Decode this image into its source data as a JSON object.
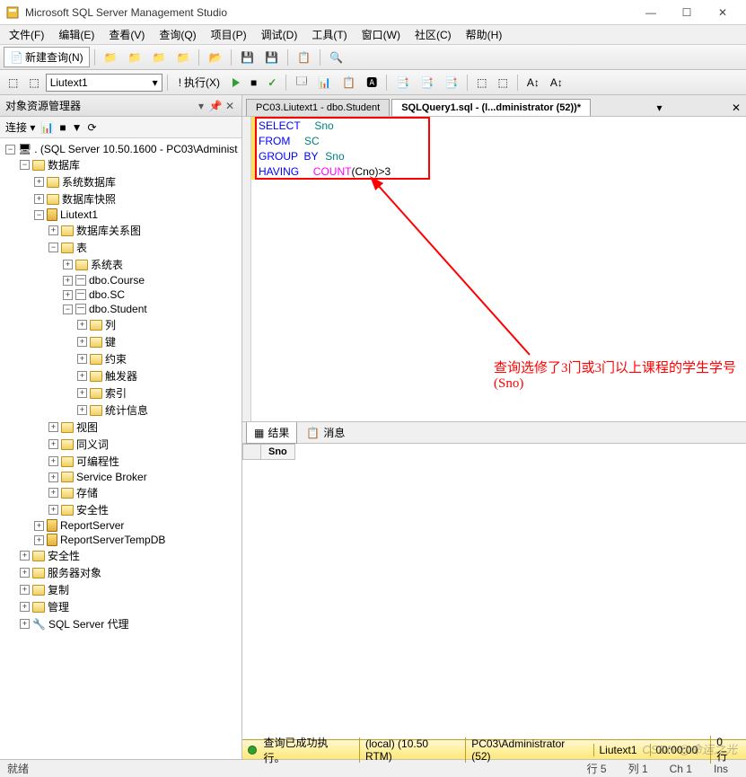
{
  "window": {
    "title": "Microsoft SQL Server Management Studio"
  },
  "menu": {
    "file": "文件(F)",
    "edit": "编辑(E)",
    "view": "查看(V)",
    "query": "查询(Q)",
    "project": "项目(P)",
    "debug": "调试(D)",
    "tools": "工具(T)",
    "window": "窗口(W)",
    "community": "社区(C)",
    "help": "帮助(H)"
  },
  "toolbar": {
    "newquery": "新建查询(N)",
    "database": "Liutext1",
    "execute": "执行(X)"
  },
  "objectExplorer": {
    "title": "对象资源管理器",
    "connect": "连接 ▾",
    "root": ". (SQL Server 10.50.1600 - PC03\\Administ",
    "nodes": {
      "databases": "数据库",
      "sysdb": "系统数据库",
      "dbsnap": "数据库快照",
      "liutext1": "Liutext1",
      "dbdiagram": "数据库关系图",
      "tables": "表",
      "systables": "系统表",
      "course": "dbo.Course",
      "sc": "dbo.SC",
      "student": "dbo.Student",
      "columns": "列",
      "keys": "键",
      "constraints": "约束",
      "triggers": "触发器",
      "indexes": "索引",
      "stats": "统计信息",
      "views": "视图",
      "synonyms": "同义词",
      "programmability": "可编程性",
      "servicebroker": "Service Broker",
      "storage": "存储",
      "security_db": "安全性",
      "reportserver": "ReportServer",
      "reportservertempdb": "ReportServerTempDB",
      "security": "安全性",
      "serverobjects": "服务器对象",
      "replication": "复制",
      "management": "管理",
      "sqlagent": "SQL Server 代理"
    }
  },
  "tabs": {
    "tab1": "PC03.Liutext1 - dbo.Student",
    "tab2": "SQLQuery1.sql - (l...dministrator (52))*"
  },
  "sql": {
    "l1_kw1": "SELECT",
    "l1_id": "Sno",
    "l2_kw": "FROM",
    "l2_id": "SC",
    "l3_kw": "GROUP  BY",
    "l3_id": "Sno",
    "l4_kw": "HAVING",
    "l4_fn": "COUNT",
    "l4_pa": "(Cno)>",
    "l4_num": "3"
  },
  "annotation": "查询选修了3门或3门以上课程的学生学号(Sno)",
  "results": {
    "tab_results": "结果",
    "tab_messages": "消息",
    "col1": "Sno"
  },
  "editorStatus": {
    "msg": "查询已成功执行。",
    "server": "(local) (10.50 RTM)",
    "user": "PC03\\Administrator (52)",
    "db": "Liutext1",
    "time": "00:00:00",
    "rows": "0 行"
  },
  "status": {
    "ready": "就绪",
    "line": "行 5",
    "col": "列 1",
    "ch": "Ch 1",
    "ins": "Ins"
  },
  "watermark": "CSDN @命运之光"
}
